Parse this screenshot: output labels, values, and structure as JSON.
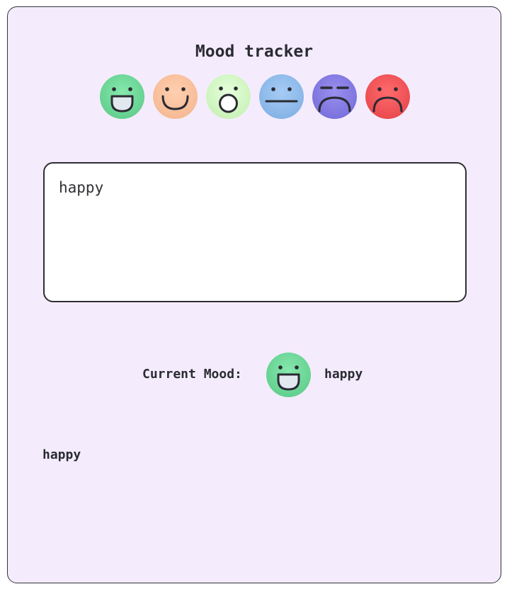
{
  "title": "Mood tracker",
  "moods": [
    {
      "name": "happy",
      "icon": "grin-face-icon",
      "color": "#72dc9d"
    },
    {
      "name": "content",
      "icon": "smile-face-icon",
      "color": "#ffc4a0"
    },
    {
      "name": "surprised",
      "icon": "surprised-face-icon",
      "color": "#d6fac8"
    },
    {
      "name": "neutral",
      "icon": "neutral-face-icon",
      "color": "#95c0ef"
    },
    {
      "name": "annoyed",
      "icon": "annoyed-face-icon",
      "color": "#8b82e6"
    },
    {
      "name": "sad",
      "icon": "sad-face-icon",
      "color": "#f75b5e"
    }
  ],
  "input": {
    "value": "happy"
  },
  "current": {
    "label": "Current Mood:",
    "value": "happy",
    "icon": "grin-face-icon"
  },
  "log": [
    "happy"
  ]
}
